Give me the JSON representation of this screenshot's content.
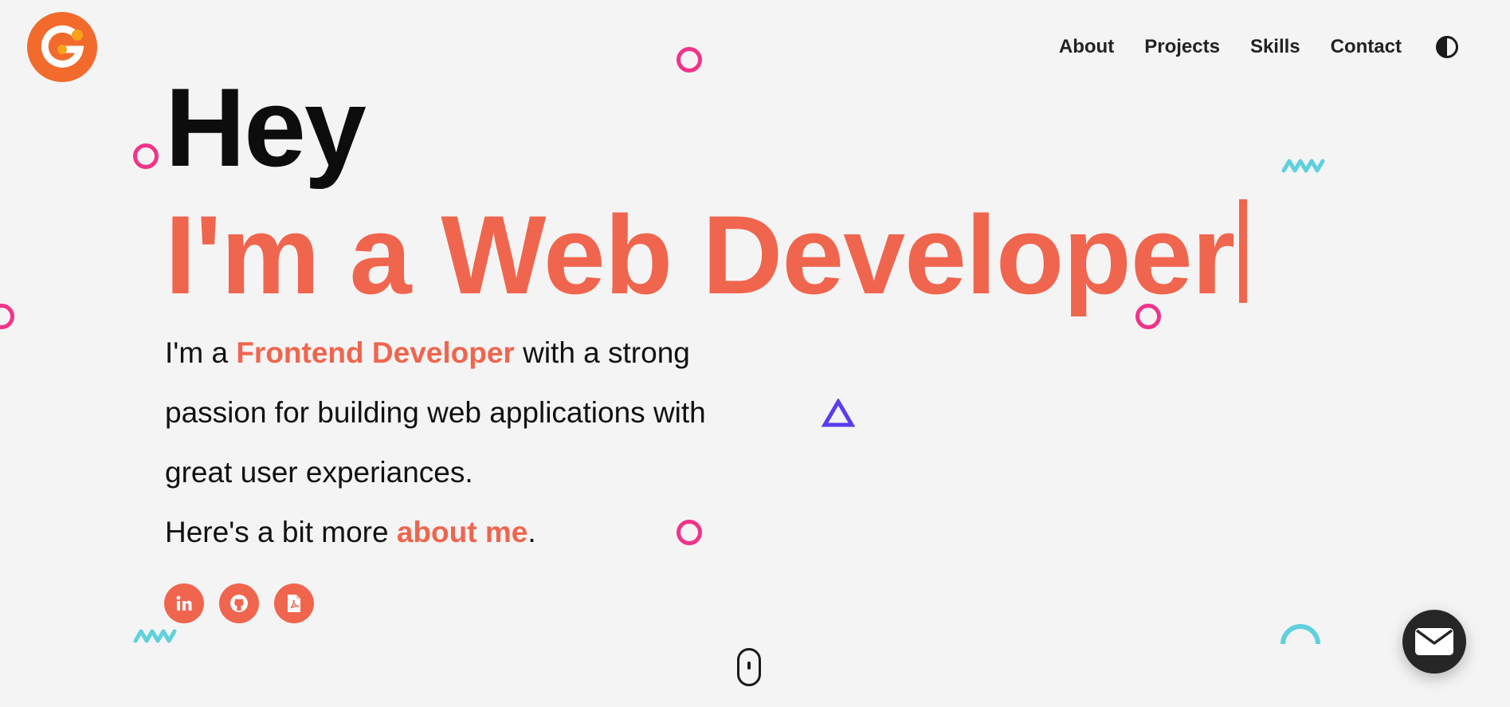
{
  "logo": {
    "letter": "G",
    "color_outer": "#f26a2c",
    "color_inner": "#f7a21b"
  },
  "nav": {
    "items": [
      {
        "label": "About"
      },
      {
        "label": "Projects"
      },
      {
        "label": "Skills"
      },
      {
        "label": "Contact"
      }
    ],
    "theme_toggle_icon": "contrast-icon"
  },
  "hero": {
    "greeting": "Hey",
    "role": "I'm a Web Developer",
    "intro": {
      "prefix": "I'm a ",
      "highlight": "Frontend Developer",
      "rest": " with a strong passion for building web applications with great user experiances.",
      "more_prefix": "Here's a bit more ",
      "more_link": "about me",
      "more_suffix": "."
    }
  },
  "socials": [
    {
      "name": "linkedin",
      "icon": "linkedin-icon"
    },
    {
      "name": "github",
      "icon": "github-icon"
    },
    {
      "name": "resume",
      "icon": "pdf-icon"
    }
  ],
  "fab": {
    "icon": "mail-icon"
  },
  "scroll_indicator": {
    "icon": "mouse-scroll-icon"
  },
  "colors": {
    "accent": "#f0654e",
    "ring": "#f2338a",
    "triangle": "#5b3cf0",
    "zigzag": "#5fd0dd",
    "background": "#f4f4f4"
  }
}
